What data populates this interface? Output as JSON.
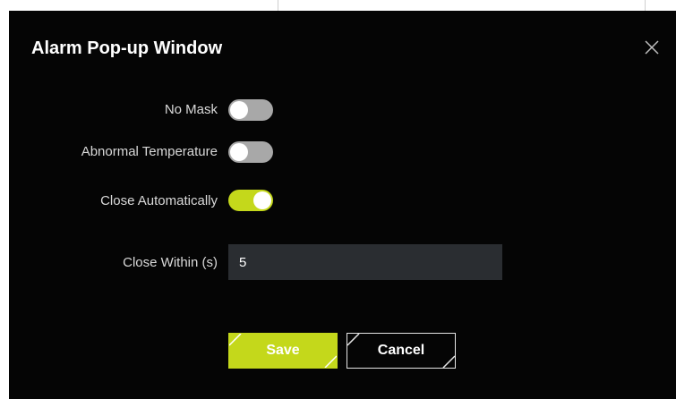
{
  "dialog": {
    "title": "Alarm Pop-up Window",
    "close_icon": "close-icon"
  },
  "settings": {
    "no_mask": {
      "label": "No Mask",
      "enabled": false
    },
    "abnormal_temperature": {
      "label": "Abnormal Temperature",
      "enabled": false
    },
    "close_automatically": {
      "label": "Close Automatically",
      "enabled": true
    },
    "close_within": {
      "label": "Close Within (s)",
      "value": "5"
    }
  },
  "buttons": {
    "save_label": "Save",
    "cancel_label": "Cancel"
  },
  "colors": {
    "accent": "#c4d81b",
    "dialog_background": "#050505",
    "input_background": "#2a2d31",
    "toggle_off": "#a8a8a8"
  }
}
